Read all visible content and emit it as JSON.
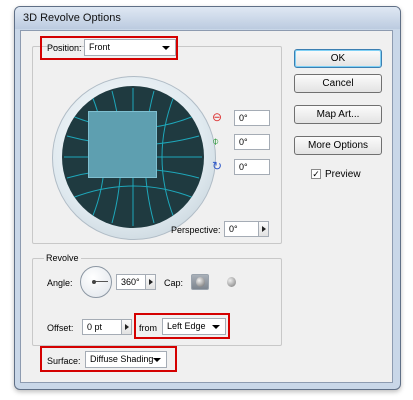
{
  "window": {
    "title": "3D Revolve Options"
  },
  "position": {
    "label": "Position:",
    "label_underline": "n",
    "value": "Front"
  },
  "rotation": {
    "x": {
      "value": "0°",
      "icon": "rotate-x-icon"
    },
    "y": {
      "value": "0°",
      "icon": "rotate-y-icon"
    },
    "z": {
      "value": "0°",
      "icon": "rotate-z-icon"
    }
  },
  "perspective": {
    "label": "Perspective:",
    "value": "0°"
  },
  "revolve": {
    "group_label": "Revolve",
    "angle_label": "Angle:",
    "angle_value": "360°",
    "cap_label": "Cap:",
    "offset_label": "Offset:",
    "offset_value": "0 pt",
    "from_label": "from",
    "from_value": "Left Edge"
  },
  "surface": {
    "label": "Surface:",
    "value": "Diffuse Shading"
  },
  "buttons": {
    "ok": "OK",
    "cancel": "Cancel",
    "map_art": "Map Art...",
    "more_options": "More Options"
  },
  "preview": {
    "label": "Preview",
    "checked": true,
    "check_mark": "✓"
  },
  "colors": {
    "highlight": "#d40000",
    "sphere_dark": "#1f3a40",
    "cube_face": "#5e9fb0",
    "grid_line": "#1fb4c8"
  }
}
